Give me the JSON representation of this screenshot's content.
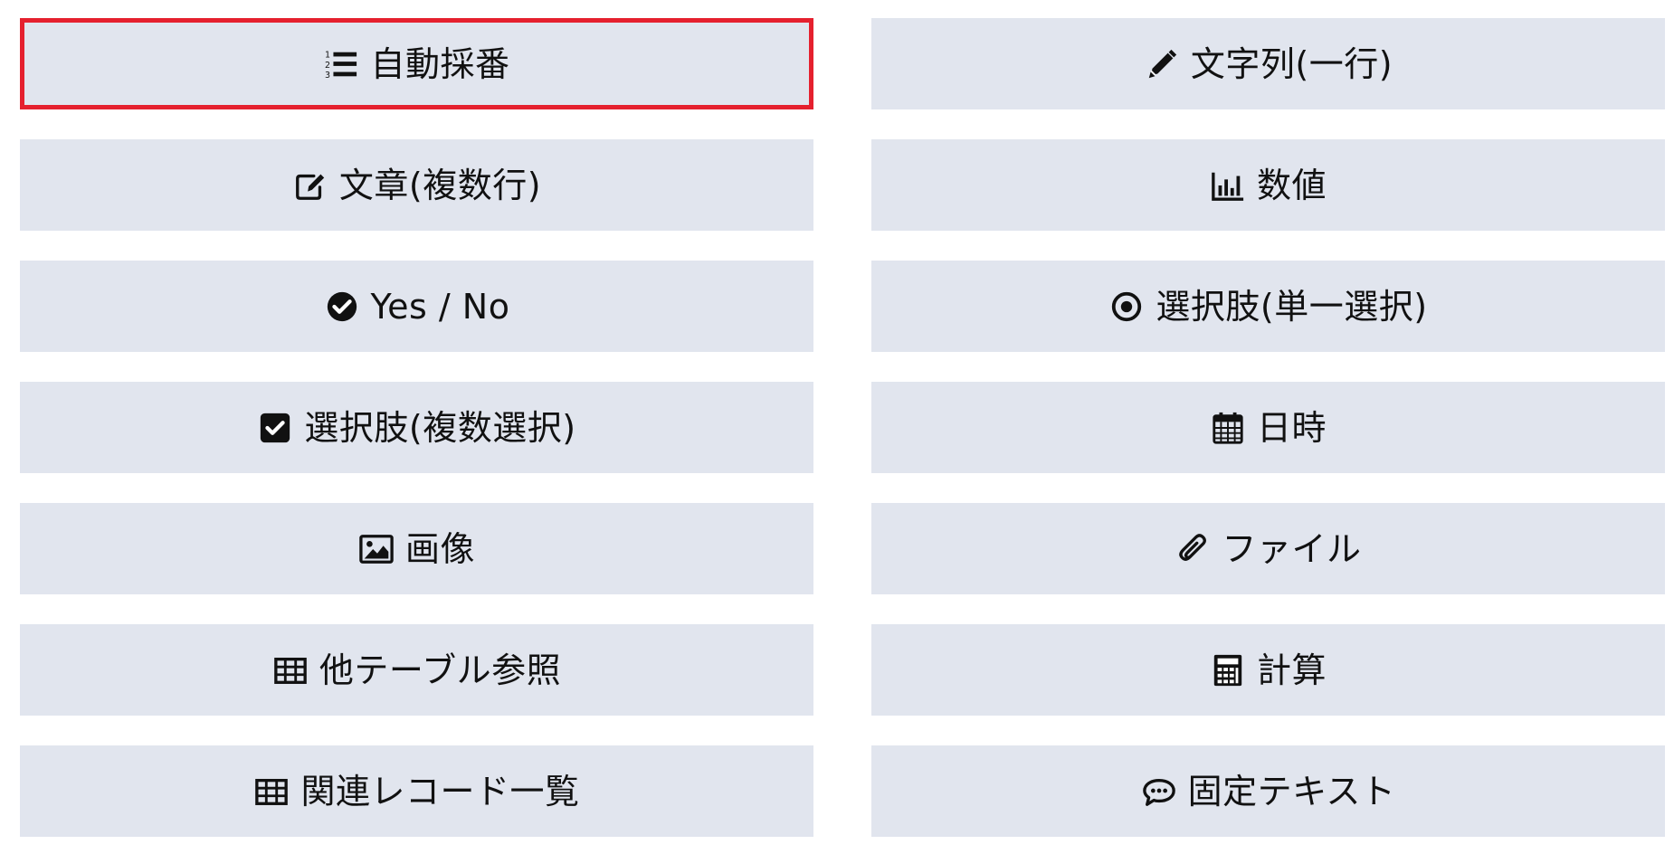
{
  "fields": [
    {
      "label": "自動採番",
      "icon": "ordered-list-icon",
      "selected": true
    },
    {
      "label": "文字列(一行)",
      "icon": "pencil-icon",
      "selected": false
    },
    {
      "label": "文章(複数行)",
      "icon": "edit-square-icon",
      "selected": false
    },
    {
      "label": "数値",
      "icon": "bar-chart-icon",
      "selected": false
    },
    {
      "label": "Yes / No",
      "icon": "check-circle-icon",
      "selected": false
    },
    {
      "label": "選択肢(単一選択)",
      "icon": "radio-dot-icon",
      "selected": false
    },
    {
      "label": "選択肢(複数選択)",
      "icon": "check-square-icon",
      "selected": false
    },
    {
      "label": "日時",
      "icon": "calendar-icon",
      "selected": false
    },
    {
      "label": "画像",
      "icon": "image-icon",
      "selected": false
    },
    {
      "label": "ファイル",
      "icon": "paperclip-icon",
      "selected": false
    },
    {
      "label": "他テーブル参照",
      "icon": "table-icon",
      "selected": false
    },
    {
      "label": "計算",
      "icon": "calculator-icon",
      "selected": false
    },
    {
      "label": "関連レコード一覧",
      "icon": "table-icon",
      "selected": false
    },
    {
      "label": "固定テキスト",
      "icon": "speech-bubble-icon",
      "selected": false
    }
  ],
  "colors": {
    "button_bg": "#e1e5ee",
    "selected_border": "#e5202e",
    "text": "#111111"
  }
}
